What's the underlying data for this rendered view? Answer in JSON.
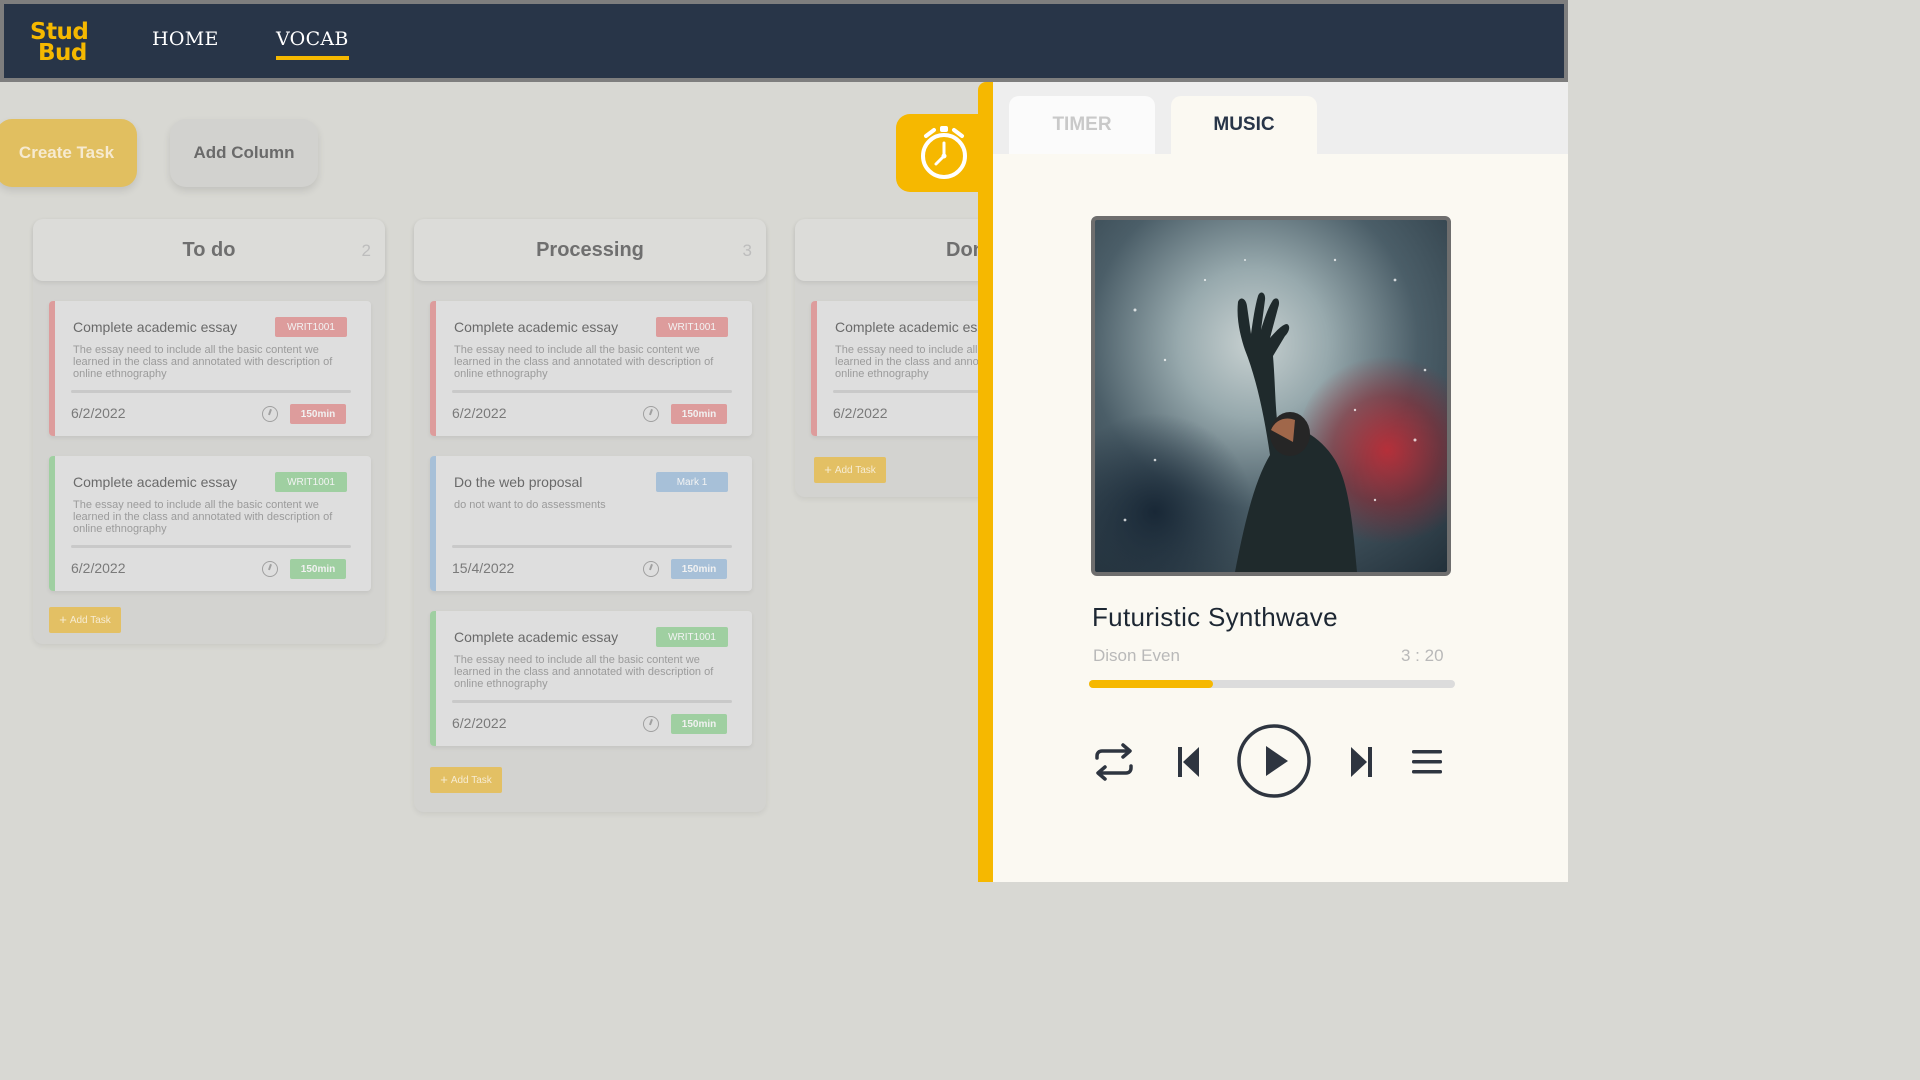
{
  "header": {
    "logo_line1": "Stud",
    "logo_line2": "Bud",
    "nav": [
      {
        "label": "HOME"
      },
      {
        "label": "VOCAB"
      }
    ]
  },
  "toolbar": {
    "create_task": "Create Task",
    "add_column": "Add Column"
  },
  "columns": [
    {
      "title": "To do",
      "count": "2",
      "add_task": "Add Task",
      "cards": [
        {
          "title": "Complete academic essay",
          "tag": "WRIT1001",
          "desc": "The essay need to include all the basic content we learned in the class and annotated with description of online ethnography",
          "date": "6/2/2022",
          "duration": "150min",
          "color": "red"
        },
        {
          "title": "Complete academic essay",
          "tag": "WRIT1001",
          "desc": "The essay need to include all the basic content we learned in the class and annotated with description of online ethnography",
          "date": "6/2/2022",
          "duration": "150min",
          "color": "green"
        }
      ]
    },
    {
      "title": "Processing",
      "count": "3",
      "add_task": "Add Task",
      "cards": [
        {
          "title": "Complete academic essay",
          "tag": "WRIT1001",
          "desc": "The essay need to include all the basic content we learned in the class and annotated with description of online ethnography",
          "date": "6/2/2022",
          "duration": "150min",
          "color": "red"
        },
        {
          "title": "Do the web proposal",
          "tag": "Mark 1",
          "desc": "do not want to do assessments",
          "date": "15/4/2022",
          "duration": "150min",
          "color": "blue"
        },
        {
          "title": "Complete academic essay",
          "tag": "WRIT1001",
          "desc": "The essay need to include all the basic content we learned in the class and annotated with description of online ethnography",
          "date": "6/2/2022",
          "duration": "150min",
          "color": "green"
        }
      ]
    },
    {
      "title": "Done",
      "count": "",
      "add_task": "Add Task",
      "cards": [
        {
          "title": "Complete academic essay",
          "tag": "",
          "desc": "The essay need to include all the basic content we learned in the class and annotated with description of online ethnography",
          "date": "6/2/2022",
          "duration": "",
          "color": "red"
        }
      ]
    }
  ],
  "panel": {
    "tabs": [
      {
        "label": "TIMER"
      },
      {
        "label": "MUSIC"
      }
    ],
    "active_tab": "MUSIC",
    "song": {
      "title": "Futuristic Synthwave",
      "artist": "Dison Even",
      "time": "3 : 20",
      "progress": 0.34
    }
  },
  "colors": {
    "accent": "#f6b800",
    "header_bg": "#283548",
    "tag_red": "#dd9c9c",
    "tag_green": "#9fcfa1",
    "tag_blue": "#a7c0d8"
  },
  "icons": [
    "alarm-clock-icon",
    "clock-icon",
    "plus-icon",
    "repeat-icon",
    "skip-previous-icon",
    "play-icon",
    "skip-next-icon",
    "playlist-icon"
  ]
}
